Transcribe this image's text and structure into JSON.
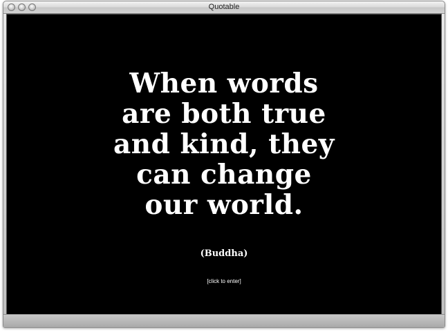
{
  "window": {
    "title": "Quotable"
  },
  "quote": {
    "lines": [
      "When words",
      "are both true",
      "and kind, they",
      "can change",
      "our world."
    ],
    "attribution": "(Buddha)"
  },
  "enter_link": "[click to enter]",
  "colors": {
    "background": "#000000",
    "text": "#ffffff",
    "chrome": "#c6c6c6"
  }
}
